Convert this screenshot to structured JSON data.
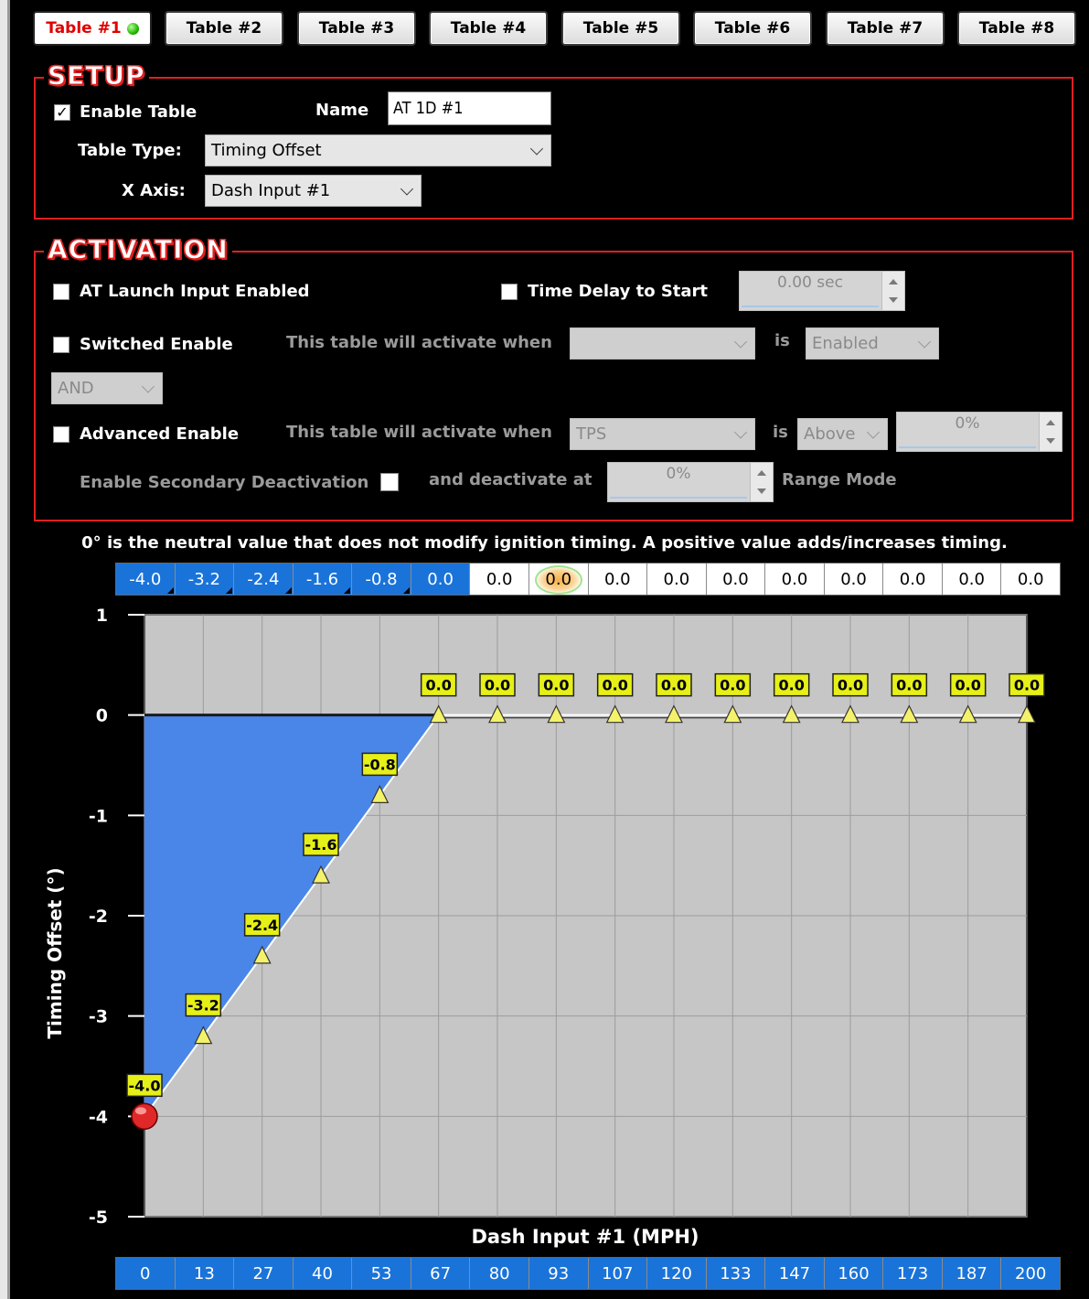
{
  "tabs": [
    {
      "label": "Table #1",
      "active": true,
      "status": "green-dot-icon"
    },
    {
      "label": "Table #2",
      "active": false
    },
    {
      "label": "Table #3",
      "active": false
    },
    {
      "label": "Table #4",
      "active": false
    },
    {
      "label": "Table #5",
      "active": false
    },
    {
      "label": "Table #6",
      "active": false
    },
    {
      "label": "Table #7",
      "active": false
    },
    {
      "label": "Table #8",
      "active": false
    }
  ],
  "setup": {
    "title": "SETUP",
    "enable_table_label": "Enable Table",
    "enable_table_checked": true,
    "name_label": "Name",
    "name_value": "AT 1D #1",
    "table_type_label": "Table Type:",
    "table_type_value": "Timing Offset",
    "x_axis_label": "X Axis:",
    "x_axis_value": "Dash Input #1"
  },
  "activation": {
    "title": "ACTIVATION",
    "at_launch_label": "AT Launch Input Enabled",
    "time_delay_label": "Time Delay to Start",
    "time_delay_value": "0.00 sec",
    "switched_enable_label": "Switched Enable",
    "activate_when_label": "This table will activate when",
    "switched_input_value": "",
    "is_label": "is",
    "switched_state_value": "Enabled",
    "logic_value": "AND",
    "advanced_enable_label": "Advanced Enable",
    "advanced_input_value": "TPS",
    "advanced_condition_value": "Above",
    "advanced_threshold_value": "0%",
    "secondary_deactivation_label": "Enable Secondary Deactivation",
    "deactivate_at_label": "and deactivate at",
    "deactivate_value": "0%",
    "range_mode_label": "Range Mode"
  },
  "note": "0° is the neutral value that does not modify ignition timing.  A positive value adds/increases timing.",
  "value_row": [
    "-4.0",
    "-3.2",
    "-2.4",
    "-1.6",
    "-0.8",
    "0.0",
    "0.0",
    "0.0",
    "0.0",
    "0.0",
    "0.0",
    "0.0",
    "0.0",
    "0.0",
    "0.0",
    "0.0"
  ],
  "axis_row": [
    "0",
    "13",
    "27",
    "40",
    "53",
    "67",
    "80",
    "93",
    "107",
    "120",
    "133",
    "147",
    "160",
    "173",
    "187",
    "200"
  ],
  "colors": {
    "accent_blue": "#1a73d9",
    "group_border": "#e02020",
    "fill_blue": "#4a86e8",
    "label_yellow": "#e8f000"
  },
  "chart_data": {
    "type": "area",
    "x": [
      0,
      13,
      27,
      40,
      53,
      67,
      80,
      93,
      107,
      120,
      133,
      147,
      160,
      173,
      187,
      200
    ],
    "values": [
      -4.0,
      -3.2,
      -2.4,
      -1.6,
      -0.8,
      0.0,
      0.0,
      0.0,
      0.0,
      0.0,
      0.0,
      0.0,
      0.0,
      0.0,
      0.0,
      0.0
    ],
    "point_labels": [
      "-4.0",
      "-3.2",
      "-2.4",
      "-1.6",
      "-0.8",
      "0.0",
      "0.0",
      "0.0",
      "0.0",
      "0.0",
      "0.0",
      "0.0",
      "0.0",
      "0.0",
      "0.0",
      "0.0"
    ],
    "xlabel": "Dash Input #1 (MPH)",
    "ylabel": "Timing Offset (°)",
    "ylim": [
      -5,
      1
    ],
    "yticks": [
      "1",
      "0",
      "-1",
      "-2",
      "-3",
      "-4",
      "-5"
    ],
    "grid": true,
    "selected_index": 0
  }
}
